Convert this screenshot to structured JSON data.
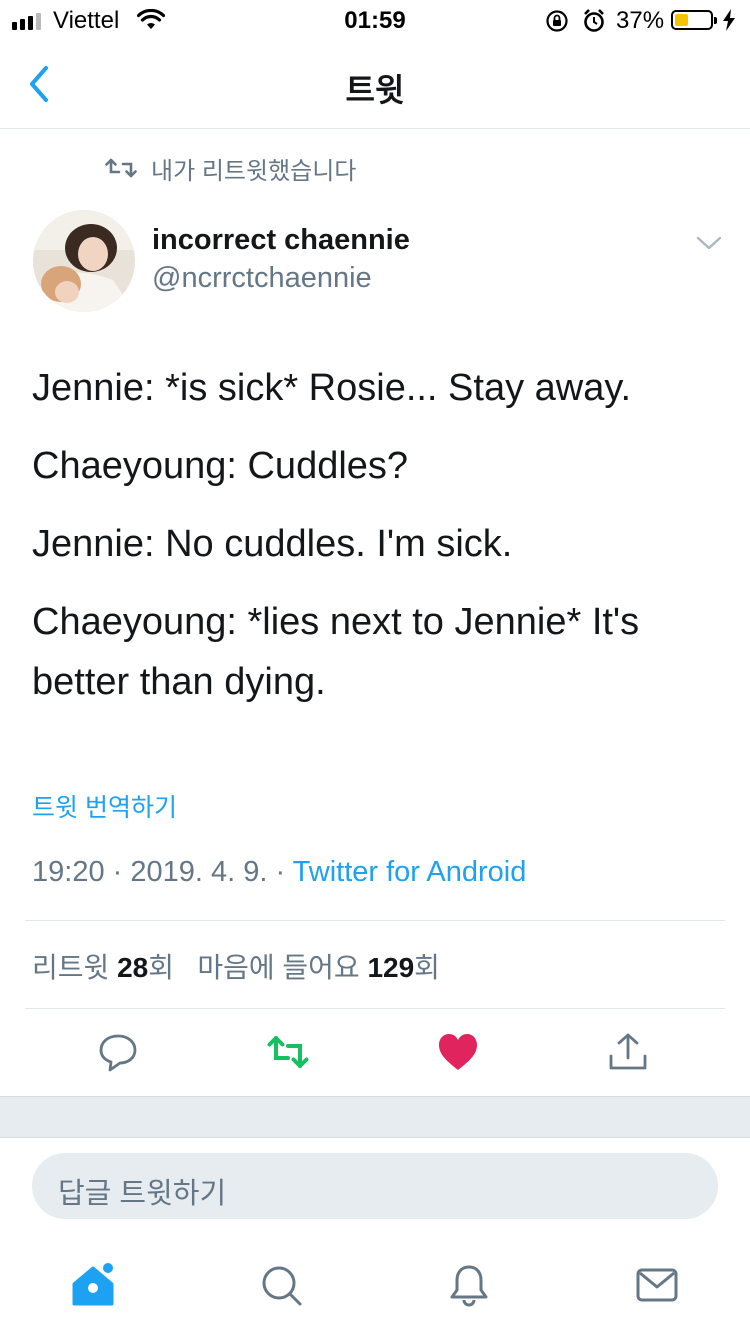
{
  "status_bar": {
    "carrier": "Viettel",
    "time": "01:59",
    "battery_pct": "37%",
    "battery_level": 0.37,
    "icons": [
      "signal-icon",
      "wifi-icon",
      "rotation-lock-icon",
      "alarm-icon",
      "battery-icon",
      "charging-bolt-icon"
    ]
  },
  "header": {
    "title": "트윗",
    "back_icon": "back-chevron-icon"
  },
  "tweet": {
    "retweeted_by": "내가 리트윗했습니다",
    "display_name": "incorrect chaennie",
    "handle": "@ncrrctchaennie",
    "body": [
      "Jennie: *is sick* Rosie... Stay away.",
      "Chaeyoung: Cuddles?",
      "Jennie: No cuddles. I'm sick.",
      "Chaeyoung: *lies next to Jennie* It's better than dying."
    ],
    "translate_label": "트윗 번역하기",
    "timestamp": "19:20 · 2019. 4. 9. · ",
    "source": "Twitter for Android",
    "stats": {
      "retweets_label": "리트윗 ",
      "retweets": "28",
      "retweets_suffix": "회",
      "likes_label": "마음에 들어요 ",
      "likes": "129",
      "likes_suffix": "회"
    }
  },
  "actions": {
    "reply_icon": "reply-icon",
    "retweet_icon": "retweet-icon",
    "like_icon": "heart-icon",
    "share_icon": "share-icon",
    "retweet_color": "#17bf63",
    "like_color": "#e0245e"
  },
  "composer": {
    "placeholder": "답글 트윗하기"
  },
  "tab_bar": {
    "tabs": [
      "home-icon",
      "search-icon",
      "notifications-icon",
      "messages-icon"
    ],
    "accent": "#1da1f2"
  }
}
